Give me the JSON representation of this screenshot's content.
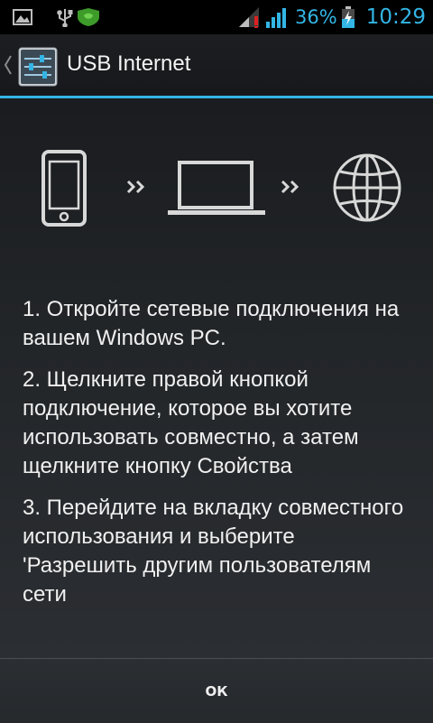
{
  "status_bar": {
    "battery_percent": "36%",
    "time": "10:29",
    "icons": [
      "image-icon",
      "usb-icon",
      "shield-icon",
      "signal-icon",
      "data-signal-icon",
      "battery-charging-icon"
    ]
  },
  "action_bar": {
    "title": "USB Internet",
    "icon": "settings-sliders-icon"
  },
  "diagram": {
    "icons": [
      "phone-icon",
      "double-chevron-icon",
      "laptop-icon",
      "double-chevron-icon",
      "globe-icon"
    ]
  },
  "steps": [
    "1. Откройте сетевые подключения на вашем Windows PC.",
    "2. Щелкните правой кнопкой подключение, которое вы хотите использовать совместно, а затем щелкните кнопку Свойства",
    "3. Перейдите на вкладку совместного использования и выберите 'Разрешить другим пользователям сети"
  ],
  "buttons": {
    "ok_label": "ОК"
  },
  "colors": {
    "accent": "#33b5e5",
    "signal_warning": "#e02020"
  }
}
